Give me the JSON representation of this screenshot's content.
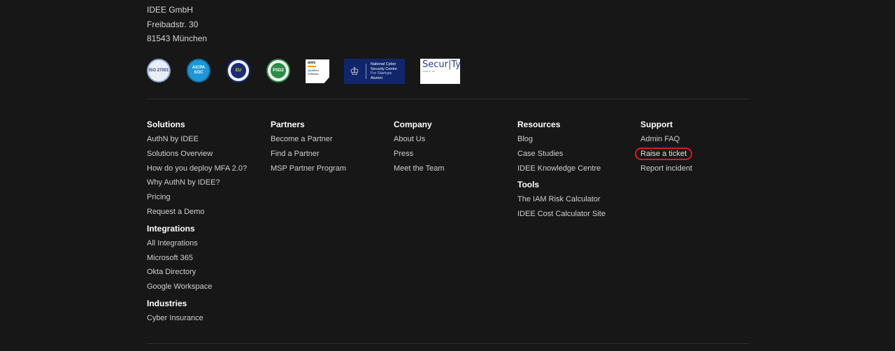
{
  "address": {
    "company": "IDEE GmbH",
    "street": "Freibadstr. 30",
    "city": "81543 München"
  },
  "badges": {
    "iso": "ISO 27001",
    "aicpa_line1": "AICPA",
    "aicpa_line2": "SOC",
    "eu": "EU",
    "psd2": "PSD2",
    "aws_brand": "aws",
    "aws_line1": "Qualified",
    "aws_line2": "Software",
    "ncsc_line1": "National Cyber",
    "ncsc_line2": "Security Centre",
    "ncsc_line3": "For Startups",
    "ncsc_line4": "Alumni",
    "secur_main": "Secur|Ty",
    "secur_small": "made in .de"
  },
  "columns": {
    "solutions": {
      "title": "Solutions",
      "items": [
        "AuthN by IDEE",
        "Solutions Overview",
        "How do you deploy MFA 2.0?",
        "Why AuthN by IDEE?",
        "Pricing",
        "Request a Demo"
      ]
    },
    "integrations": {
      "title": "Integrations",
      "items": [
        "All Integrations",
        "Microsoft 365",
        "Okta Directory",
        "Google Workspace"
      ]
    },
    "industries": {
      "title": "Industries",
      "items": [
        "Cyber Insurance"
      ]
    },
    "partners": {
      "title": "Partners",
      "items": [
        "Become a Partner",
        "Find a Partner",
        "MSP Partner Program"
      ]
    },
    "company": {
      "title": "Company",
      "items": [
        "About Us",
        "Press",
        "Meet the Team"
      ]
    },
    "resources": {
      "title": "Resources",
      "items": [
        "Blog",
        "Case Studies",
        "IDEE Knowledge Centre"
      ]
    },
    "tools": {
      "title": "Tools",
      "items": [
        "The IAM Risk Calculator",
        "IDEE Cost Calculator Site"
      ]
    },
    "support": {
      "title": "Support",
      "items": [
        "Admin FAQ",
        "Raise a ticket",
        "Report incident"
      ]
    }
  },
  "colors": {
    "background": "#171717",
    "highlight_ring": "#e0171c"
  }
}
